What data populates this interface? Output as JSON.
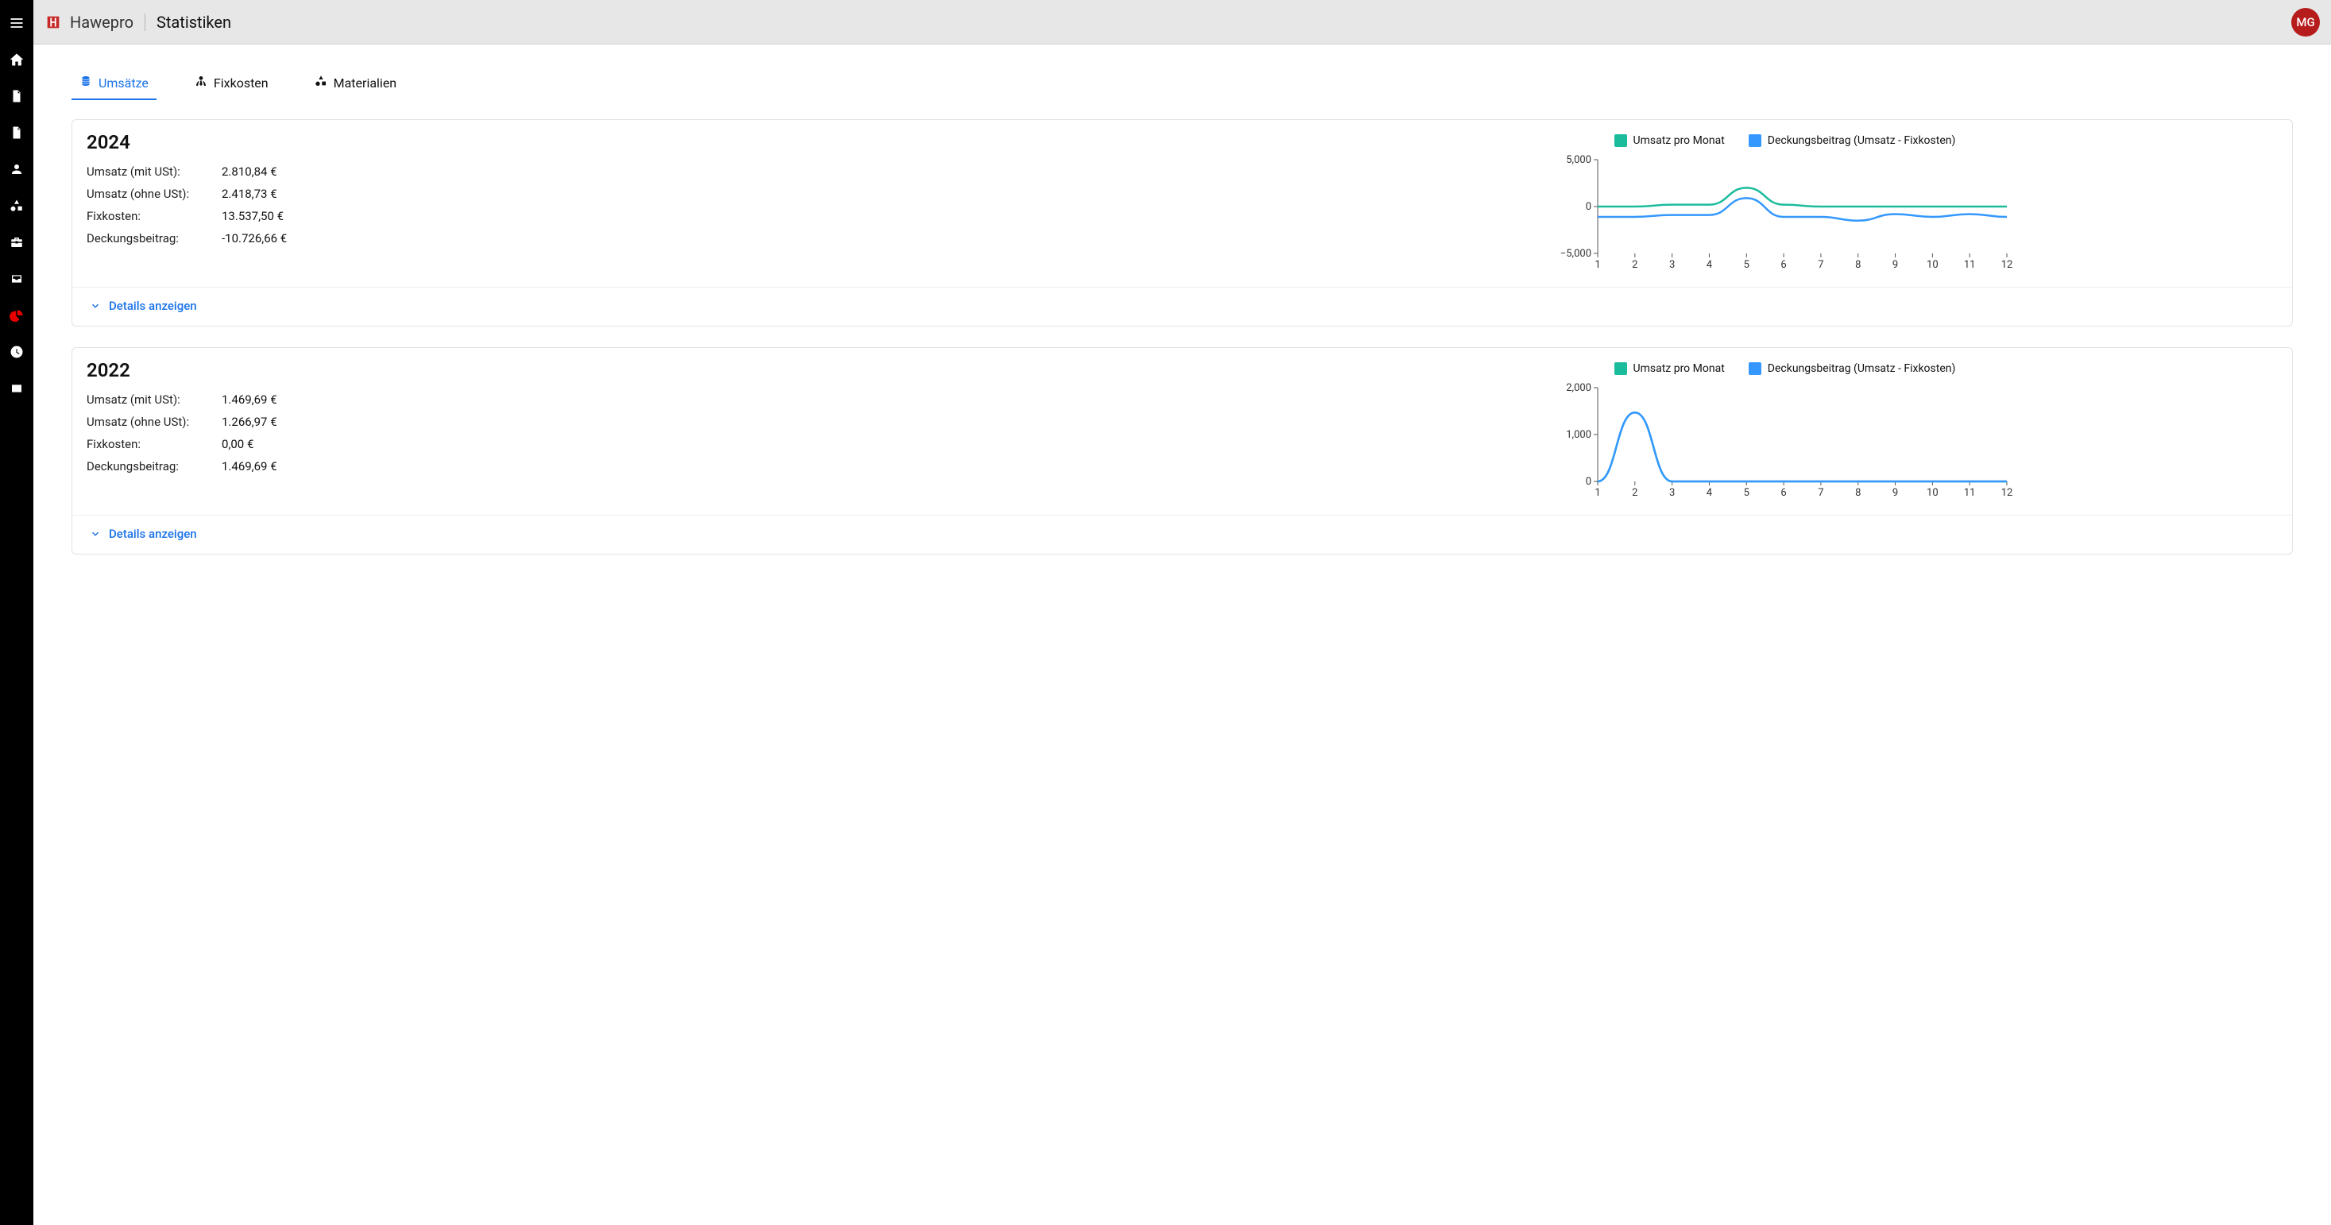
{
  "brand": "Hawepro",
  "page_title": "Statistiken",
  "avatar": "MG",
  "tabs": [
    {
      "label": "Umsätze",
      "icon": "coins-icon",
      "active": true
    },
    {
      "label": "Fixkosten",
      "icon": "person-tie-icon",
      "active": false
    },
    {
      "label": "Materialien",
      "icon": "shapes-icon",
      "active": false
    }
  ],
  "stat_labels": {
    "umsatz_mit_ust": "Umsatz (mit USt):",
    "umsatz_ohne_ust": "Umsatz (ohne USt):",
    "fixkosten": "Fixkosten:",
    "deckungsbeitrag": "Deckungsbeitrag:"
  },
  "legend": {
    "series_a": "Umsatz pro Monat",
    "series_b": "Deckungsbeitrag (Umsatz - Fixkosten)"
  },
  "details_button": "Details anzeigen",
  "cards": [
    {
      "year": "2024",
      "stats": {
        "umsatz_mit_ust": "2.810,84 €",
        "umsatz_ohne_ust": "2.418,73 €",
        "fixkosten": "13.537,50 €",
        "deckungsbeitrag": "-10.726,66 €"
      }
    },
    {
      "year": "2022",
      "stats": {
        "umsatz_mit_ust": "1.469,69 €",
        "umsatz_ohne_ust": "1.266,97 €",
        "fixkosten": "0,00 €",
        "deckungsbeitrag": "1.469,69 €"
      }
    }
  ],
  "chart_data": [
    {
      "type": "line",
      "title": "2024",
      "x": [
        1,
        2,
        3,
        4,
        5,
        6,
        7,
        8,
        9,
        10,
        11,
        12
      ],
      "ylim": [
        -5000,
        5000
      ],
      "yticks": [
        -5000,
        0,
        5000
      ],
      "ytick_labels": [
        "−5,000",
        "0",
        "5,000"
      ],
      "xlabel": "",
      "ylabel": "",
      "series": [
        {
          "name": "Umsatz pro Monat",
          "color": "#1abc9c",
          "values": [
            0,
            0,
            200,
            200,
            2000,
            200,
            0,
            0,
            0,
            0,
            0,
            0
          ]
        },
        {
          "name": "Deckungsbeitrag (Umsatz - Fixkosten)",
          "color": "#3498ff",
          "values": [
            -1100,
            -1100,
            -900,
            -900,
            900,
            -1100,
            -1100,
            -1500,
            -800,
            -1100,
            -800,
            -1100
          ]
        }
      ]
    },
    {
      "type": "line",
      "title": "2022",
      "x": [
        1,
        2,
        3,
        4,
        5,
        6,
        7,
        8,
        9,
        10,
        11,
        12
      ],
      "ylim": [
        0,
        2000
      ],
      "yticks": [
        0,
        1000,
        2000
      ],
      "ytick_labels": [
        "0",
        "1,000",
        "2,000"
      ],
      "xlabel": "",
      "ylabel": "",
      "series": [
        {
          "name": "Umsatz pro Monat",
          "color": "#1abc9c",
          "values": [
            0,
            1470,
            0,
            0,
            0,
            0,
            0,
            0,
            0,
            0,
            0,
            0
          ]
        },
        {
          "name": "Deckungsbeitrag (Umsatz - Fixkosten)",
          "color": "#3498ff",
          "values": [
            0,
            1470,
            0,
            0,
            0,
            0,
            0,
            0,
            0,
            0,
            0,
            0
          ]
        }
      ]
    }
  ],
  "sidebar_icons": [
    "menu-icon",
    "home-icon",
    "file-icon",
    "file-invoice-icon",
    "user-icon",
    "shapes-icon",
    "toolbox-icon",
    "inbox-icon",
    "pie-chart-icon",
    "clock-icon",
    "id-card-icon"
  ]
}
